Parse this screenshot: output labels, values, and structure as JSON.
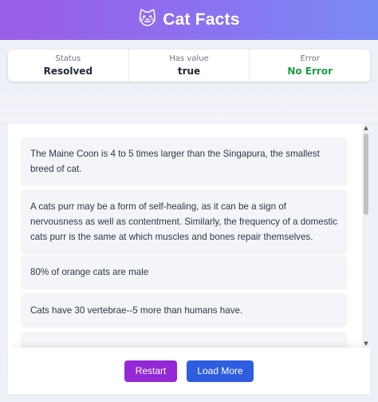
{
  "header": {
    "title": "Cat Facts",
    "icon": "cat-face-icon"
  },
  "status": {
    "status_label": "Status",
    "status_value": "Resolved",
    "has_value_label": "Has value",
    "has_value_value": "true",
    "error_label": "Error",
    "error_value": "No Error"
  },
  "facts": [
    "The Maine Coon is 4 to 5 times larger than the Singapura, the smallest breed of cat.",
    "A cats purr may be a form of self-healing, as it can be a sign of nervousness as well as contentment. Similarly, the frequency of a domestic cats purr is the same at which muscles and bones repair themselves.",
    "80% of orange cats are male",
    "Cats have 30 vertebrae--5 more than humans have."
  ],
  "buttons": {
    "restart": "Restart",
    "load_more": "Load More"
  },
  "colors": {
    "accent_gradient_start": "#9b5de5",
    "accent_gradient_end": "#7a8af5",
    "success": "#1e9a41",
    "restart": "#9228d6",
    "load_more": "#2f5de0"
  }
}
